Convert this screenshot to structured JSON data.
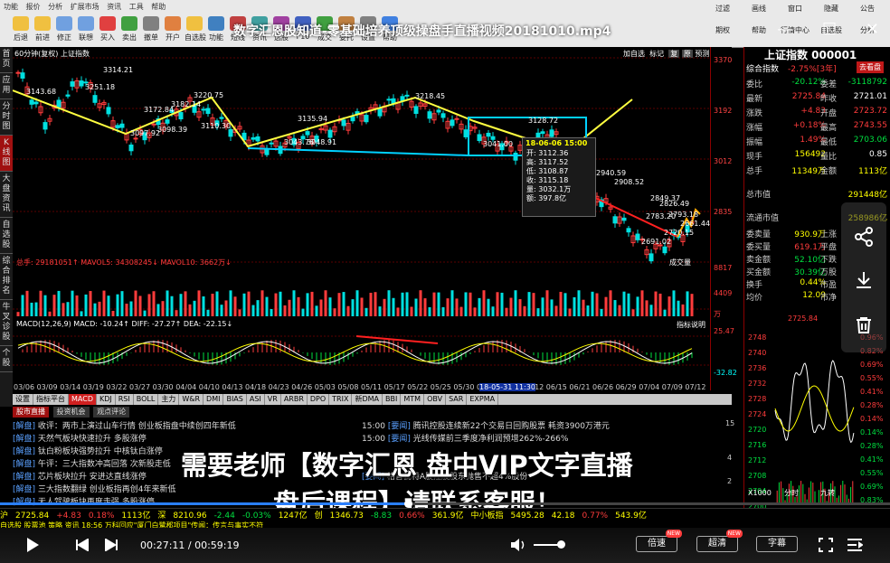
{
  "window": {
    "video_title": "数字汇恩股知道-零基础培养顶级操盘手直播视频20181010.mp4",
    "controls": [
      "—",
      "☐",
      "✕"
    ]
  },
  "menu": [
    "功能",
    "报价",
    "分析",
    "扩展市场",
    "资讯",
    "工具",
    "帮助"
  ],
  "toolbar": [
    {
      "label": "后退",
      "icon": "back-icon"
    },
    {
      "label": "前进",
      "icon": "forward-icon"
    },
    {
      "label": "修正",
      "icon": "edit-icon"
    },
    {
      "label": "联想",
      "icon": "link-icon"
    },
    {
      "label": "买入",
      "icon": "buy-icon"
    },
    {
      "label": "卖出",
      "icon": "sell-icon"
    },
    {
      "label": "撤单",
      "icon": "cancel-icon"
    },
    {
      "label": "开户",
      "icon": "account-icon"
    },
    {
      "label": "自选股",
      "icon": "star-icon"
    },
    {
      "label": "功能",
      "icon": "func-icon"
    },
    {
      "label": "短线",
      "icon": "short-icon"
    },
    {
      "label": "资讯",
      "icon": "news-icon"
    },
    {
      "label": "选股",
      "icon": "pick-icon"
    },
    {
      "label": "F10",
      "icon": "f10-icon"
    },
    {
      "label": "成交",
      "icon": "deal-icon"
    },
    {
      "label": "委托",
      "icon": "entrust-icon"
    },
    {
      "label": "设置",
      "icon": "settings-icon"
    },
    {
      "label": "帮助",
      "icon": "help-icon"
    }
  ],
  "toolbar_right": [
    "过滤",
    "画线",
    "窗口",
    "隐藏",
    "公告",
    "期权",
    "帮助",
    "行情中心",
    "自选股",
    "分析"
  ],
  "sidebar_tabs": [
    "首页",
    "应用",
    "分时图",
    "K线图",
    "大盘资讯",
    "自选股",
    "综合排名",
    "牛叉诊股",
    "个股"
  ],
  "chart_header": {
    "title": "60分钟(复权) 上证指数",
    "right_tools": [
      "加自选",
      "标记",
      "复",
      "原",
      "预测"
    ]
  },
  "price_axis": [
    "3370",
    "3192",
    "3012",
    "2835"
  ],
  "kline_labels": [
    "3314.21",
    "3251.18",
    "3143.68",
    "3220.75",
    "3172.84",
    "3182.14",
    "3097.92",
    "3098.39",
    "3110.30",
    "3135.94",
    "3218.45",
    "3043.76",
    "3048.91",
    "3128.72",
    "3041.00",
    "2940.59",
    "2908.52",
    "2849.37",
    "2826.49",
    "2783.20",
    "2793.18",
    "2691.02",
    "2720.15",
    "2661.44"
  ],
  "tooltip": {
    "datetime": "18-06-06 15:00",
    "rows": [
      "开: 3112.36",
      "高: 3117.52",
      "低: 3108.87",
      "收: 3115.18",
      "量: 3032.1万",
      "额: 397.8亿"
    ]
  },
  "volume_panel": {
    "label": "成交量",
    "values": "总手: 29181051↑  MAVOL5: 34308245↓  MAVOL10: 3662万↓",
    "axis": [
      "8817",
      "4409"
    ],
    "unit": "万"
  },
  "macd_panel": {
    "label": "MACD(12,26,9)  MACD: -10.24↑  DIFF: -27.27↑  DEA: -22.15↓",
    "tip": "指标说明",
    "axis": [
      "25.47",
      "-32.82"
    ]
  },
  "x_axis": [
    "03/06",
    "03/09",
    "03/14",
    "03/19",
    "03/22",
    "03/27",
    "03/30",
    "04/04",
    "04/10",
    "04/13",
    "04/18",
    "04/23",
    "04/26",
    "05/03",
    "05/08",
    "05/11",
    "05/17",
    "05/22",
    "05/25",
    "05/30",
    "06/04",
    "06/07",
    "06/12",
    "06/15",
    "06/21",
    "06/26",
    "06/29",
    "07/04",
    "07/09",
    "07/12"
  ],
  "x_axis_highlight": "18-05-31 11:30",
  "indicator_tabs": [
    "设置",
    "指标平台",
    "MACD",
    "KDJ",
    "RSI",
    "BOLL",
    "主力",
    "W&R",
    "DMI",
    "BIAS",
    "ASI",
    "VR",
    "ARBR",
    "DPO",
    "TRIX",
    "新DMA",
    "BBI",
    "MTM",
    "OBV",
    "SAR",
    "EXPMA"
  ],
  "news": {
    "tabs": [
      "股市直播",
      "投资机会",
      "观点评论"
    ],
    "left": [
      {
        "tag": "[解盘]",
        "text": "收评：两市上演过山车行情 创业板指盘中续创四年新低"
      },
      {
        "tag": "[解盘]",
        "text": "天然气板块快速拉升 多股涨停"
      },
      {
        "tag": "[解盘]",
        "text": "钛白粉板块强势拉升 中核钛白涨停"
      },
      {
        "tag": "[解盘]",
        "text": "午评：三大指数冲高回落 次新股走低"
      },
      {
        "tag": "[解盘]",
        "text": "芯片板块拉升 安进达直线涨停"
      },
      {
        "tag": "[解盘]",
        "text": "三大指数翻绿 创业板指再创4年来新低"
      },
      {
        "tag": "[解盘]",
        "text": "无人驾驶板块再度走强 多股涨停"
      }
    ],
    "right": [
      {
        "time": "15:00",
        "tag": "[要闻]",
        "text": "腾讯控股连续新22个交易日回购股票 耗资3900万港元"
      },
      {
        "time": "15:00",
        "tag": "[要闻]",
        "text": "光线传媒前三季度净利润预增262%-266%"
      },
      {
        "time": "",
        "tag": "",
        "text": ""
      },
      {
        "time": "",
        "tag": "",
        "text": ""
      },
      {
        "time": "",
        "tag": "[要闻]",
        "text": "格普瓦特A股控股股东抛售不超4%股份"
      }
    ],
    "scroll_nums": [
      "15",
      "4",
      "2"
    ]
  },
  "ad_overlay": {
    "line1": "需要老师【数字汇恩 盘中VIP文字直播",
    "line2": "盘后课程】请联系客服！"
  },
  "right_panel": {
    "title": "上证指数 000001",
    "sub": "综合指数",
    "change_pct": "-2.75%[3年]",
    "button": "去看盘",
    "rows": [
      {
        "k": "委比",
        "v": "-20.12%",
        "vc": "grn",
        "k2": "委差",
        "v2": "-3118792",
        "v2c": "grn"
      },
      {
        "k": "最新",
        "v": "2725.84",
        "vc": "red",
        "k2": "昨收",
        "v2": "2721.01",
        "v2c": "wht"
      },
      {
        "k": "涨跌",
        "v": "+4.83",
        "vc": "red",
        "k2": "开盘",
        "v2": "2723.72",
        "v2c": "red"
      },
      {
        "k": "涨幅",
        "v": "+0.18%",
        "vc": "red",
        "k2": "最高",
        "v2": "2743.55",
        "v2c": "red"
      },
      {
        "k": "振幅",
        "v": "1.49%",
        "vc": "red",
        "k2": "最低",
        "v2": "2703.06",
        "v2c": "grn"
      },
      {
        "k": "现手",
        "v": "156492",
        "vc": "yel",
        "k2": "量比",
        "v2": "0.85",
        "v2c": "wht"
      },
      {
        "k": "总手",
        "v": "11349万",
        "vc": "yel",
        "k2": "金额",
        "v2": "1113亿",
        "v2c": "yel"
      },
      {
        "k": "总市值",
        "v": "",
        "vc": "wht",
        "k2": "",
        "v2": "291448亿",
        "v2c": "yel"
      },
      {
        "k": "流通市值",
        "v": "",
        "vc": "wht",
        "k2": "",
        "v2": "258986亿",
        "v2c": "yel"
      },
      {
        "k": "委卖量",
        "v": "930.9万",
        "vc": "yel",
        "k2": "上涨",
        "v2": "",
        "v2c": "red"
      },
      {
        "k": "委买量",
        "v": "619.1万",
        "vc": "red",
        "k2": "平盘",
        "v2": "",
        "v2c": "wht"
      },
      {
        "k": "卖金额",
        "v": "52.10亿",
        "vc": "grn",
        "k2": "下跌",
        "v2": "",
        "v2c": "grn"
      },
      {
        "k": "买金额",
        "v": "30.39亿",
        "vc": "grn",
        "k2": "万股",
        "v2": "",
        "v2c": "wht"
      },
      {
        "k": "换手",
        "v": "0.44%",
        "vc": "yel",
        "k2": "市盈",
        "v2": "",
        "v2c": "wht"
      },
      {
        "k": "均价",
        "v": "12.09",
        "vc": "yel",
        "k2": "市净",
        "v2": "",
        "v2c": "wht"
      }
    ],
    "mini_price": "2725.84",
    "mini_axis_left": [
      "2748",
      "2740",
      "2736",
      "2732",
      "2728",
      "2724",
      "2720",
      "2716",
      "2712",
      "2708",
      "2704",
      "2700"
    ],
    "mini_axis_right": [
      "0.96%",
      "0.82%",
      "0.69%",
      "0.55%",
      "0.41%",
      "0.28%",
      "0.14%",
      "0.14%",
      "0.28%",
      "0.41%",
      "0.55%",
      "0.69%",
      "0.83%"
    ],
    "mini_bottom": [
      "X1000",
      "分时",
      "九转"
    ]
  },
  "status": {
    "line": [
      "沪",
      "2725.84",
      "+4.83",
      "0.18%",
      "1113亿",
      "深",
      "8210.96",
      "-2.44",
      "-0.03%",
      "1247亿",
      "创",
      "1346.73",
      "-8.83",
      "0.66%",
      "361.9亿",
      "中小板指",
      "5495.28",
      "42.18",
      "0.77%",
      "543.9亿"
    ],
    "ticker": "自选股  股票池  策略  资讯  18:56 万科回应\"厦门白鹭郡项目\"传闻：传言与事实不符"
  },
  "player": {
    "time": "00:27:11 / 00:59:19",
    "progress": 0.458,
    "buttons": {
      "speed": "倍速",
      "quality": "超清",
      "subtitle": "字幕"
    },
    "badge_new": "NEW"
  }
}
